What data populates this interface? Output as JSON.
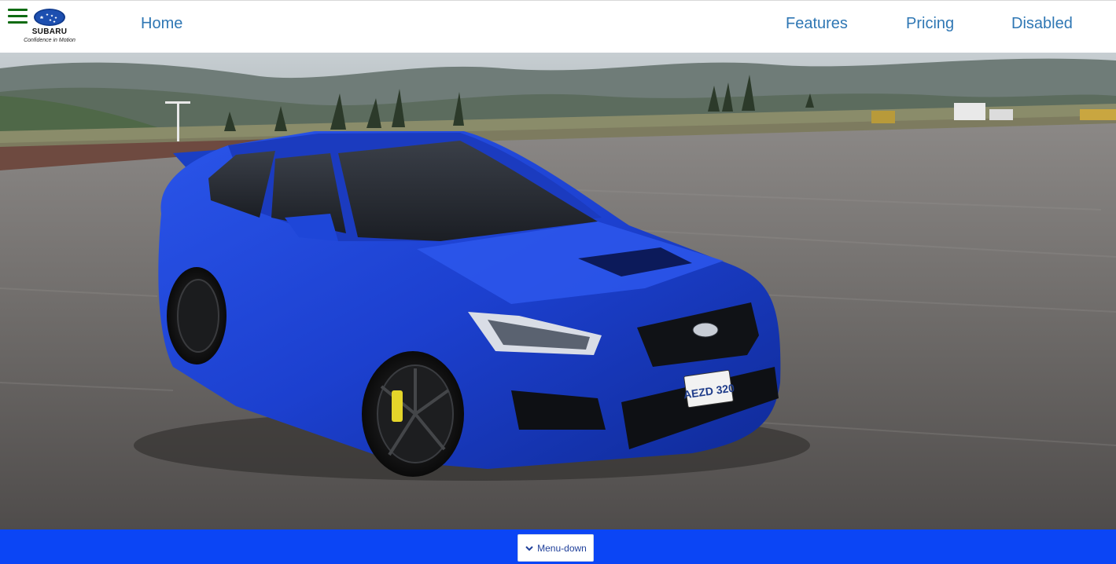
{
  "header": {
    "logo": {
      "brand": "SUBARU",
      "tagline": "Confidence in Motion"
    },
    "nav": {
      "home": "Home",
      "features": "Features",
      "pricing": "Pricing",
      "disabled": "Disabled"
    }
  },
  "hero": {
    "plate_text": "AEZD 320"
  },
  "footer": {
    "menu_button_label": "Menu-down"
  },
  "colors": {
    "nav_link": "#2f77b4",
    "hamburger": "#0e6b12",
    "bottom_bar": "#0b45f5",
    "car_blue": "#1a3fd0"
  },
  "icons": [
    "hamburger-menu-icon",
    "subaru-logo",
    "chevron-down-icon"
  ]
}
